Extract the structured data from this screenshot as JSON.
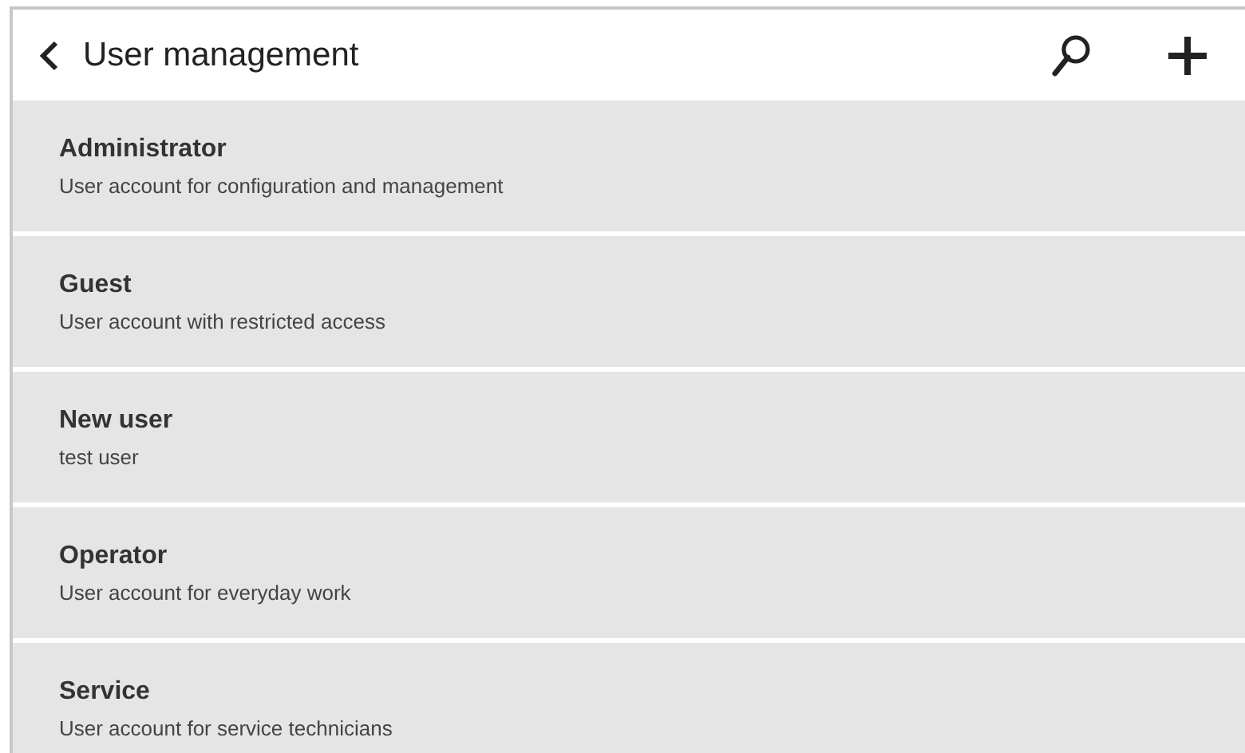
{
  "header": {
    "title": "User management"
  },
  "users": [
    {
      "name": "Administrator",
      "description": "User account for configuration and management"
    },
    {
      "name": "Guest",
      "description": "User account with restricted access"
    },
    {
      "name": "New user",
      "description": "test user"
    },
    {
      "name": "Operator",
      "description": "User account for everyday work"
    },
    {
      "name": "Service",
      "description": "User account for service technicians"
    }
  ]
}
